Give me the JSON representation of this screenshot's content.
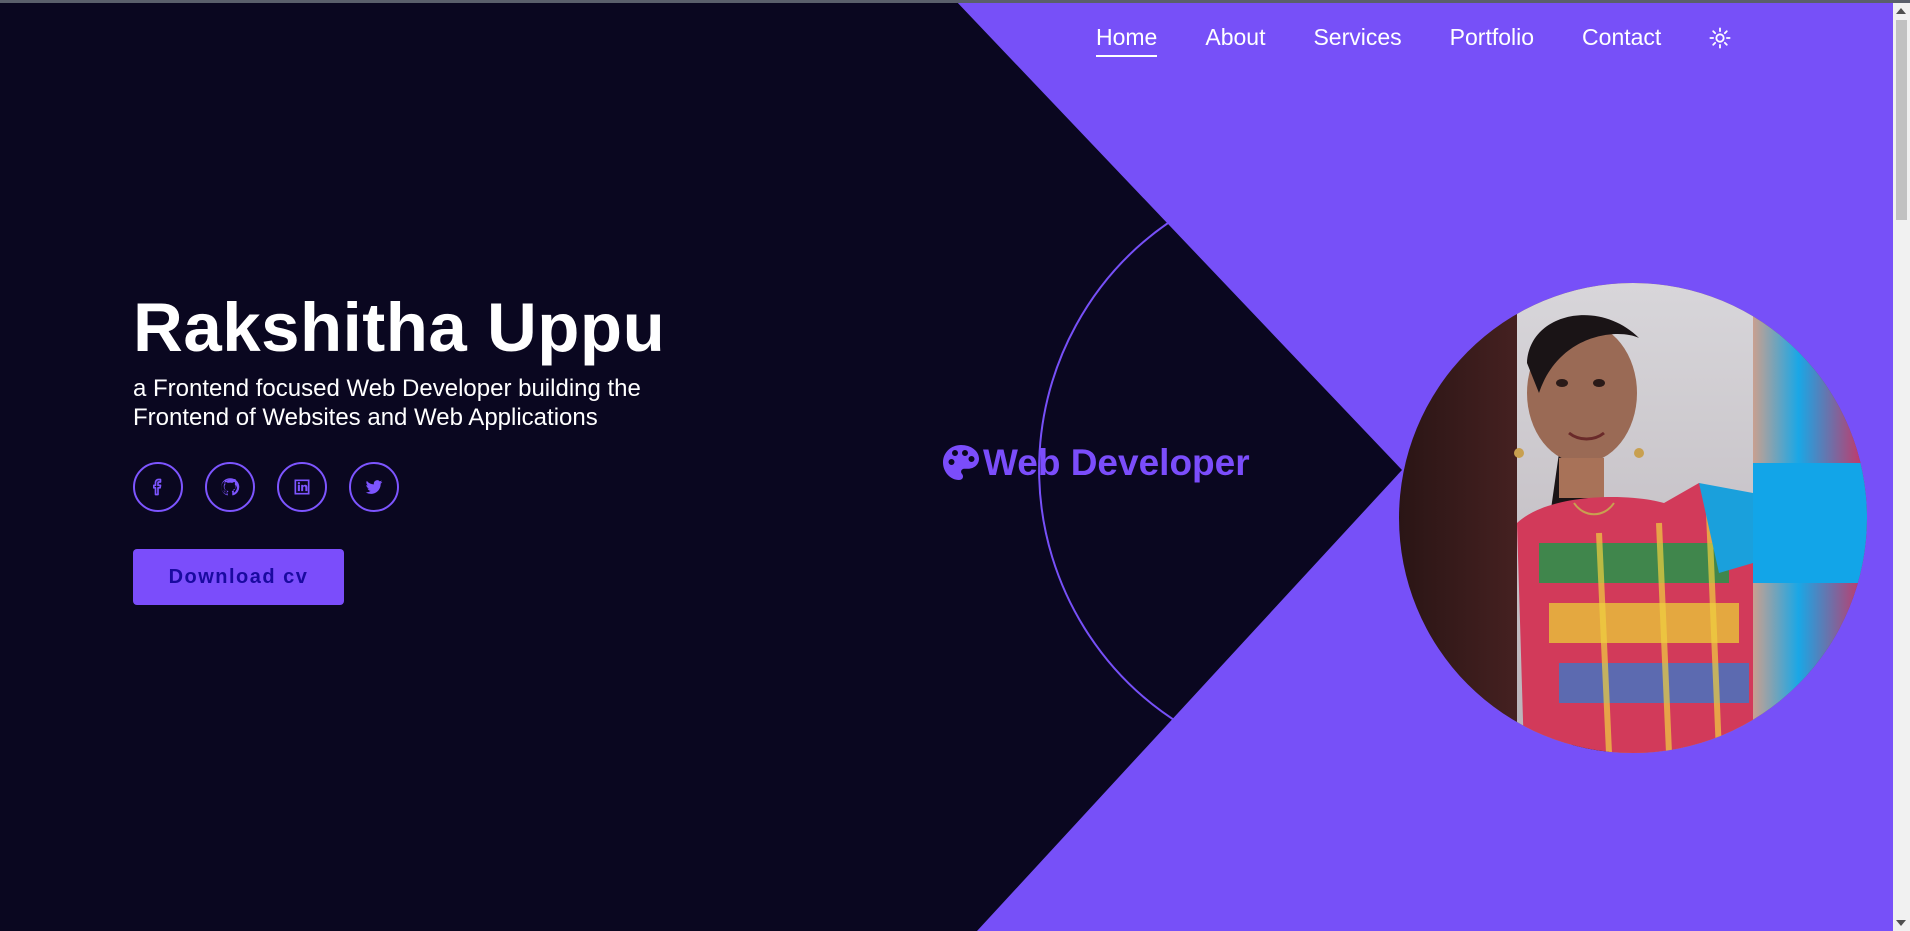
{
  "nav": {
    "items": [
      {
        "label": "Home",
        "active": true
      },
      {
        "label": "About",
        "active": false
      },
      {
        "label": "Services",
        "active": false
      },
      {
        "label": "Portfolio",
        "active": false
      },
      {
        "label": "Contact",
        "active": false
      }
    ],
    "theme_toggle_icon": "sun-icon"
  },
  "hero": {
    "name": "Rakshitha Uppu",
    "tagline": "a Frontend focused Web Developer building the Frontend of Websites and Web Applications",
    "socials": [
      {
        "icon": "facebook-icon"
      },
      {
        "icon": "github-icon"
      },
      {
        "icon": "linkedin-icon"
      },
      {
        "icon": "twitter-icon"
      }
    ],
    "download_label": "Download cv"
  },
  "role": {
    "icon": "palette-icon",
    "label": "Web Developer"
  },
  "colors": {
    "background": "#0a0720",
    "accent": "#7b4dfb",
    "text": "#ffffff"
  }
}
